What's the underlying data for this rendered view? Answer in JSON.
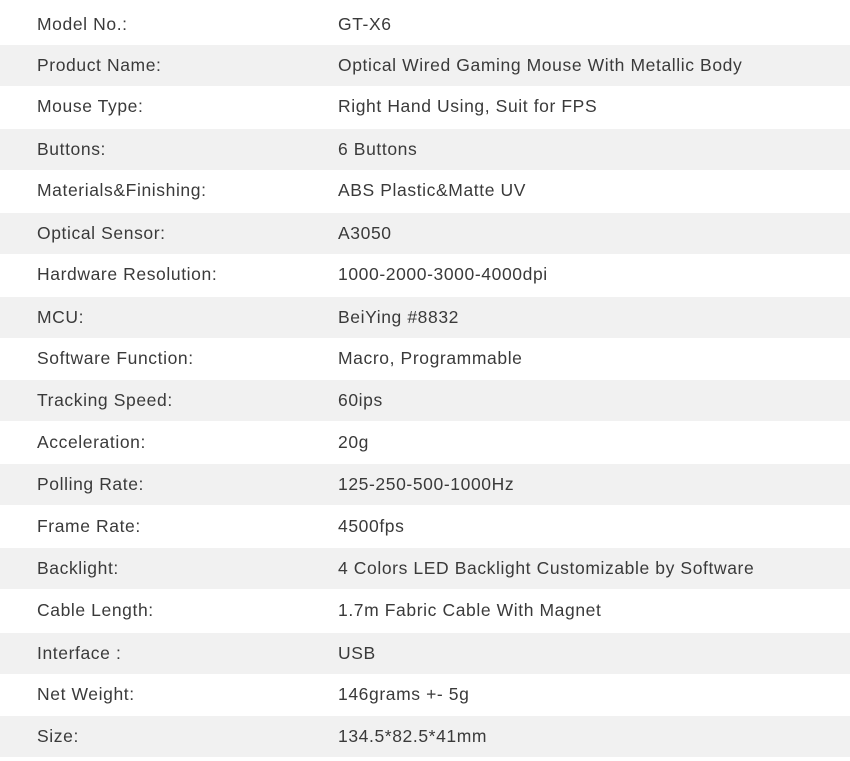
{
  "specs": [
    {
      "label": "Model No.:",
      "value": "GT-X6"
    },
    {
      "label": "Product Name:",
      "value": "Optical Wired Gaming Mouse With Metallic Body"
    },
    {
      "label": "Mouse Type:",
      "value": "Right Hand Using, Suit for FPS"
    },
    {
      "label": "Buttons:",
      "value": "6 Buttons"
    },
    {
      "label": "Materials&Finishing:",
      "value": "ABS Plastic&Matte UV"
    },
    {
      "label": "Optical Sensor:",
      "value": "A3050"
    },
    {
      "label": "Hardware Resolution:",
      "value": "1000-2000-3000-4000dpi"
    },
    {
      "label": "MCU:",
      "value": "BeiYing #8832"
    },
    {
      "label": "Software Function:",
      "value": "Macro, Programmable"
    },
    {
      "label": "Tracking Speed:",
      "value": "60ips"
    },
    {
      "label": "Acceleration:",
      "value": "20g"
    },
    {
      "label": "Polling Rate:",
      "value": "125-250-500-1000Hz"
    },
    {
      "label": "Frame Rate:",
      "value": "4500fps"
    },
    {
      "label": "Backlight:",
      "value": "4 Colors LED Backlight Customizable by Software"
    },
    {
      "label": "Cable Length:",
      "value": "1.7m Fabric Cable With Magnet"
    },
    {
      "label": "Interface :",
      "value": "USB"
    },
    {
      "label": "Net Weight:",
      "value": "146grams +- 5g"
    },
    {
      "label": "Size:",
      "value": "134.5*82.5*41mm"
    }
  ],
  "colors": {
    "row_alt": "#f1f1f1",
    "text": "#3a3a3a"
  }
}
